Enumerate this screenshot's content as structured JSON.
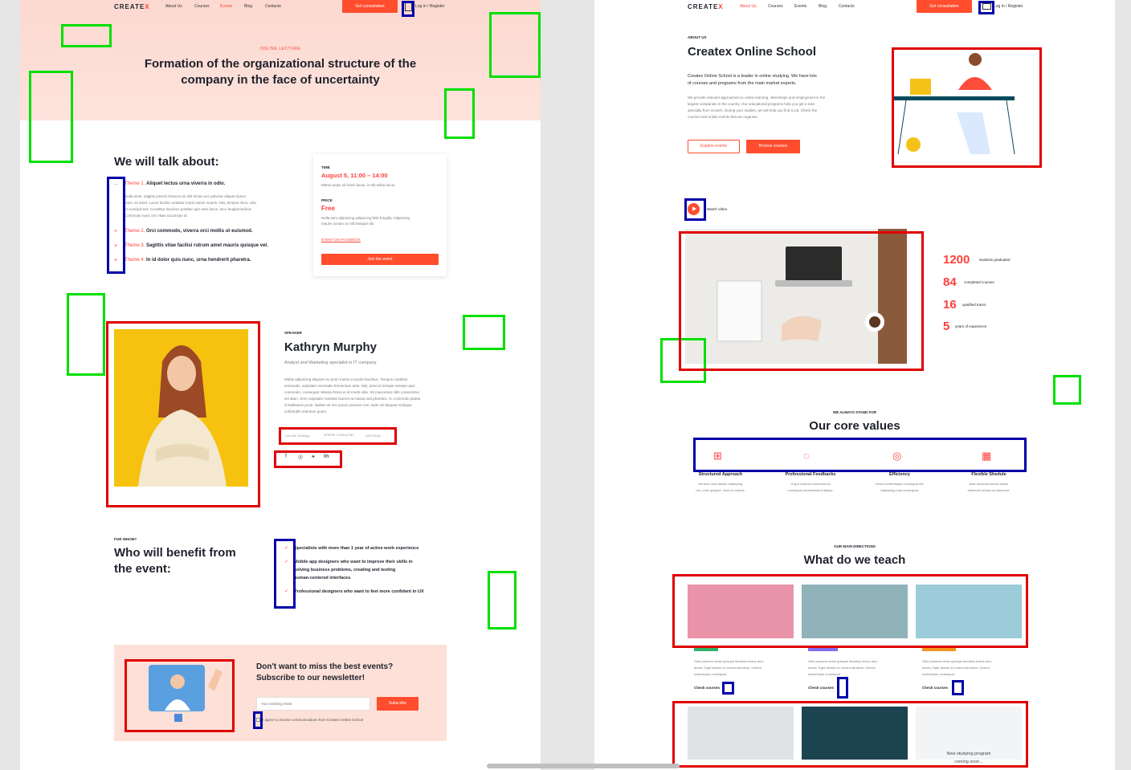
{
  "left": {
    "nav": {
      "logo": "CREATE",
      "logo_x": "X",
      "links": [
        "About Us",
        "Courses",
        "Events",
        "Blog",
        "Contacts"
      ],
      "cta": "Get consultation",
      "login": "Log in / Register"
    },
    "hero": {
      "eyebrow": "ONLINE LECTURE",
      "title_line1": "Formation of the organizational structure of the",
      "title_line2": "company in the face of uncertainty"
    },
    "talk": {
      "heading": "We will talk about:",
      "themes": [
        {
          "num": "Theme 1.",
          "title": "Aliquet lectus urna viverra in odio.",
          "sign": "–"
        },
        {
          "num": "Theme 2.",
          "title": "Orci commodo, viverra orci mollis ut euismod.",
          "sign": "+"
        },
        {
          "num": "Theme 3.",
          "title": "Sagittis vitae facilisi rutrum amet mauris quisque vel.",
          "sign": "+"
        },
        {
          "num": "Theme 4.",
          "title": "In id dolor quis nunc, urna hendrerit pharetra.",
          "sign": "+"
        }
      ],
      "theme1_body": [
        "Nulla amet, sagittis potenti rhoncus sit. Elit lectus nec pulvinar aliquet donec",
        "enim, sit amet. Lacus facilisi curabitur turpis varius mauris. Nisi, tempus risus, odio",
        "mi suscipit sed. Curabitur faucibus porttitor quis sem lacus, arcu feugiat facilisis.",
        "Commodo nunc orci vitae accumsan id."
      ]
    },
    "event_card": {
      "time_label": "TIME",
      "time_value": "August 5, 11:00 – 14:00",
      "time_note": "Metus turpis sit lorem lacus, in elit tellus lacus.",
      "price_label": "PRICE",
      "price_value": "Free",
      "price_note_1": "Nulla sem adipiscing adipiscing felis fringilla. Adipiscing",
      "price_note_2": "mauris sceam ac elit tristique dis.",
      "fb_link": "EVENT ON FACEBOOK",
      "join": "Join the event"
    },
    "speaker": {
      "label": "SPEAKER",
      "name": "Kathryn Murphy",
      "role": "Analyst and Marketing specialist in IT company",
      "bio": [
        "Mattis adipiscing aliquam eu proin metus a iaculis faucibus. Tempus curabitur",
        "venenatis, vulputate venenatis fermentum ante. Nisl, amet id semper semper quis",
        "commodo, consequat. Massa rhoncus sit morbi odio. Sit maecenas nibh consectetur",
        "vel diam. Sem vulputate molestie laoreet at massa sed pharetra. Ac commodo platea",
        "id habitasse proin. Nullam sit nec ipsum posuere non. Nam vel aliquam tristique",
        "sollicitudin interdum quam."
      ],
      "logos": [
        "Get Mar Strategy",
        "SPHERE CONSULTING",
        "NATIONAL"
      ]
    },
    "whom": {
      "eyebrow": "FOR WHOM?",
      "heading1": "Who will benefit from",
      "heading2": "the event:",
      "items": [
        "Specialists with more than 1 year of active work experience",
        "Mobile app designers who want to improve their skills in",
        "solving business problems, creating and testing",
        "human-centered interfaces",
        "Professional designers who want to feel more confident in UX"
      ]
    },
    "newsletter": {
      "heading1": "Don't want to miss the best events?",
      "heading2": "Subscribe to our newsletter!",
      "placeholder": "Your working email",
      "button": "Subscribe",
      "consent": "I agree to receive communications from Createx Online School"
    }
  },
  "right": {
    "nav": {
      "logo": "CREATE",
      "logo_x": "X",
      "links": [
        "About Us",
        "Courses",
        "Events",
        "Blog",
        "Contacts"
      ],
      "cta": "Get consultation",
      "login": "Log in / Register"
    },
    "about": {
      "eyebrow": "ABOUT US",
      "title": "Createx Online School",
      "lead1": "Createx Online School is a leader in online studying. We have lots",
      "lead2": "of courses and programs from the main market experts.",
      "body": [
        "We provide relevant approaches to online learning, internships and employment in the",
        "largest companies in the country. Our educational programs help you get a new",
        "specialty from scratch. During your studies, we will help you find a job. Check the",
        "courses and online events that we organise."
      ],
      "btn_events": "Explore events",
      "btn_courses": "Browse courses"
    },
    "video": {
      "label": "Watch Video"
    },
    "stats": [
      {
        "value": "1200",
        "label": "students graduated"
      },
      {
        "value": "84",
        "label": "completed courses"
      },
      {
        "value": "16",
        "label": "qualified tutors"
      },
      {
        "value": "5",
        "label": "years of experience"
      }
    ],
    "values": {
      "eyebrow": "WE ALWAYS STAND FOR",
      "title": "Our core values",
      "items": [
        {
          "title": "Structured Approach",
          "l1": "Aenean urna dictum adipiscing",
          "l2": "nec, cras quisque. Nunc in mauris."
        },
        {
          "title": "Professional Feedbacks",
          "l1": "Culpa nostrud commodo ea",
          "l2": "consequat reprehenderit aliquip."
        },
        {
          "title": "Efficiency",
          "l1": "Viverra scelerisque consequat net.",
          "l2": "Adipiscing cras consequat."
        },
        {
          "title": "Flexible Shedule",
          "l1": "Aute eiusmod dolore dolore",
          "l2": "deserunt veniam ad deserunt."
        }
      ]
    },
    "teach": {
      "eyebrow": "OUR MAIN DIRECTIONS",
      "title": "What do we teach",
      "card_text": [
        "Odio posuere netus quisque faucibus lectus arcu",
        "donec. Eget dictum eu viverra faucibus. Viverra",
        "scelerisque consequat."
      ],
      "check": "Check courses",
      "new_program1": "New studying program",
      "new_program2": "coming soon..."
    }
  },
  "colors": {
    "accent": "#ff3f3a",
    "button": "#ff4d2d",
    "hero_bg": "#fcd9d0"
  }
}
